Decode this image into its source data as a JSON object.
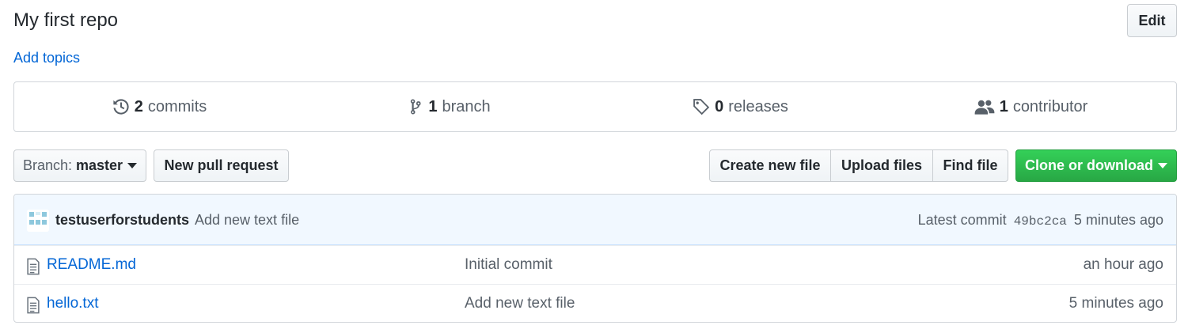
{
  "repo": {
    "description": "My first repo",
    "add_topics": "Add topics",
    "edit_label": "Edit"
  },
  "summary": [
    {
      "icon": "history-icon",
      "count": "2",
      "label": "commits"
    },
    {
      "icon": "branch-icon",
      "count": "1",
      "label": "branch"
    },
    {
      "icon": "tag-icon",
      "count": "0",
      "label": "releases"
    },
    {
      "icon": "people-icon",
      "count": "1",
      "label": "contributor"
    }
  ],
  "toolbar": {
    "branch_label": "Branch:",
    "branch_value": "master",
    "new_pr": "New pull request",
    "create_file": "Create new file",
    "upload_files": "Upload files",
    "find_file": "Find file",
    "clone": "Clone or download"
  },
  "commit": {
    "author": "testuserforstudents",
    "message": "Add new text file",
    "latest_label": "Latest commit",
    "sha": "49bc2ca",
    "age": "5 minutes ago"
  },
  "files": [
    {
      "icon": "file-icon",
      "name": "README.md",
      "message": "Initial commit",
      "age": "an hour ago"
    },
    {
      "icon": "file-icon",
      "name": "hello.txt",
      "message": "Add new text file",
      "age": "5 minutes ago"
    }
  ],
  "colors": {
    "link": "#0366d6",
    "primary_button": "#28a745",
    "commit_bar": "#f1f8ff"
  }
}
